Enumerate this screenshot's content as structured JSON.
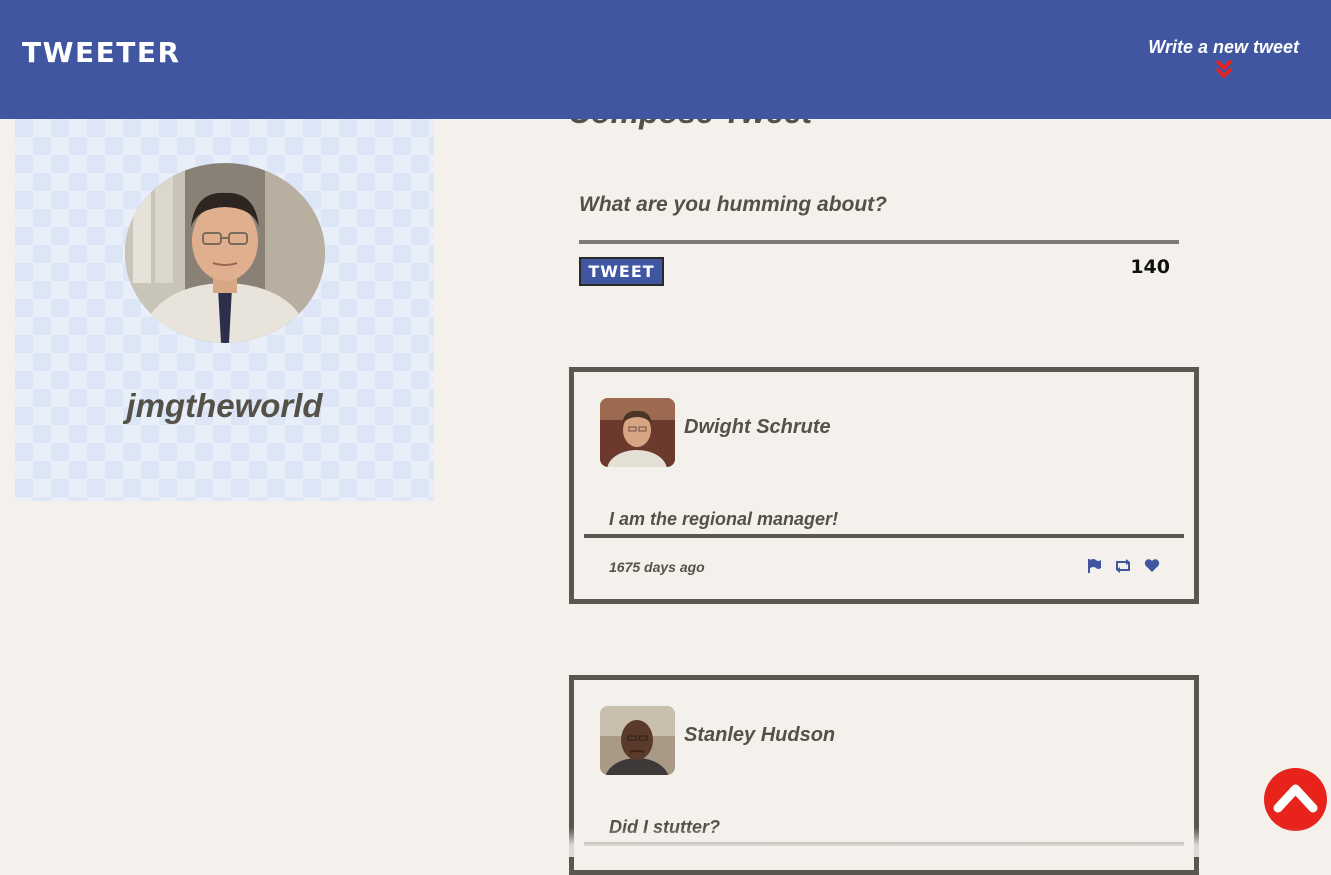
{
  "nav": {
    "brand": "TWEETER",
    "compose_toggle_label": "Write a new tweet",
    "compose_toggle_icon": "double-chevron-down-icon"
  },
  "profile": {
    "handle": "jmgtheworld",
    "avatar_icon": "user-avatar"
  },
  "composer": {
    "title": "Compose Tweet",
    "placeholder": "What are you humming about?",
    "value": "",
    "submit_label": "TWEET",
    "char_count": "140"
  },
  "tweets": [
    {
      "author": "Dwight Schrute",
      "text": "I am the regional manager!",
      "time": "1675 days ago",
      "actions": [
        "flag-icon",
        "retweet-icon",
        "heart-icon"
      ]
    },
    {
      "author": "Stanley Hudson",
      "text": "Did I stutter?",
      "time": "",
      "actions": []
    }
  ],
  "scroll_top_icon": "chevron-up-icon",
  "colors": {
    "nav": "#4056a1",
    "background": "#f4f1ec",
    "text": "#545149",
    "accent": "#e8231c",
    "profile_bg": "#dde6f6"
  }
}
